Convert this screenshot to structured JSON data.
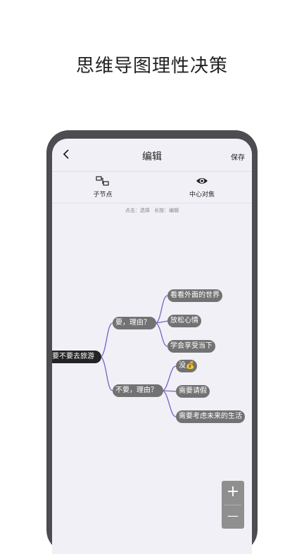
{
  "headline": "思维导图理性决策",
  "nav": {
    "title": "编辑",
    "save_label": "保存",
    "back_icon": "chevron-left-icon"
  },
  "toolbar": {
    "child_node_label": "子节点",
    "child_node_icon": "child-node-icon",
    "center_focus_label": "中心对焦",
    "center_focus_icon": "eye-icon"
  },
  "hint": "点击：选择 长按：编辑",
  "mindmap": {
    "root": "要不要去旅游",
    "branches": [
      {
        "label": "要，理由？",
        "children": [
          "看看外面的世界",
          "放松心情",
          "学会享受当下"
        ]
      },
      {
        "label": "不要，理由？",
        "children": [
          "没💰",
          "需要请假",
          "需要考虑未来的生活"
        ]
      }
    ],
    "link_color": "#7b5fc4"
  },
  "zoom": {
    "plus": "+",
    "minus": "—"
  },
  "colors": {
    "screen_bg": "#f1f0f6",
    "node_bg": "#727272",
    "root_bg": "#232325",
    "frame": "#4d4d51"
  }
}
